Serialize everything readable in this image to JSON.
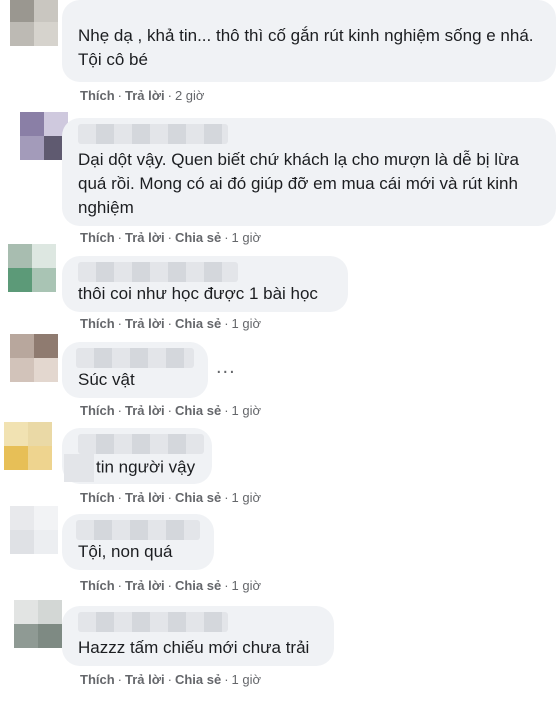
{
  "comments": [
    {
      "text": "Nhẹ dạ , khả tin... thô thì cố gắn rút kinh nghiệm sống e nhá. Tội cô bé",
      "like": "Thích",
      "reply": "Trả lời",
      "time": "2 giờ"
    },
    {
      "text": "Dại dột vậy. Quen biết chứ khách lạ cho mượn là dễ bị lừa quá rồi. Mong có ai đó giúp đỡ em mua cái mới và rút kinh nghiệm",
      "like": "Thích",
      "reply": "Trả lời",
      "share": "Chia sẻ",
      "time": "1 giờ"
    },
    {
      "text": "thôi coi như học được 1 bài học",
      "like": "Thích",
      "reply": "Trả lời",
      "share": "Chia sẻ",
      "time": "1 giờ"
    },
    {
      "text": "Súc vật",
      "like": "Thích",
      "reply": "Trả lời",
      "share": "Chia sẻ",
      "time": "1 giờ",
      "more": "..."
    },
    {
      "text": "tin người vậy",
      "like": "Thích",
      "reply": "Trả lời",
      "share": "Chia sẻ",
      "time": "1 giờ"
    },
    {
      "text": "Tội, non quá",
      "like": "Thích",
      "reply": "Trả lời",
      "share": "Chia sẻ",
      "time": "1 giờ"
    },
    {
      "text": "Hazzz tấm chiếu mới chưa trải",
      "like": "Thích",
      "reply": "Trả lời",
      "share": "Chia sẻ",
      "time": "1 giờ"
    }
  ],
  "avatar_colors": [
    [
      "#9a9790",
      "#c9c6c0",
      "#bdbab4",
      "#d6d3cd"
    ],
    [
      "#8a7fa6",
      "#cfc9de",
      "#a39bba",
      "#5f5a70"
    ],
    [
      "#a8bdb0",
      "#dde7e1",
      "#5c9a78",
      "#a9c4b4"
    ],
    [
      "#b8a79d",
      "#8f7b70",
      "#d2c3ba",
      "#e3d7cf"
    ],
    [
      "#f1e2b2",
      "#ead9a6",
      "#e7bf57",
      "#eed48f"
    ],
    [
      "#e8e9ec",
      "#f2f3f5",
      "#dfe1e5",
      "#eceef1"
    ],
    [
      "#e2e4e3",
      "#d3d7d5",
      "#8f9a94",
      "#7e8a83"
    ]
  ]
}
